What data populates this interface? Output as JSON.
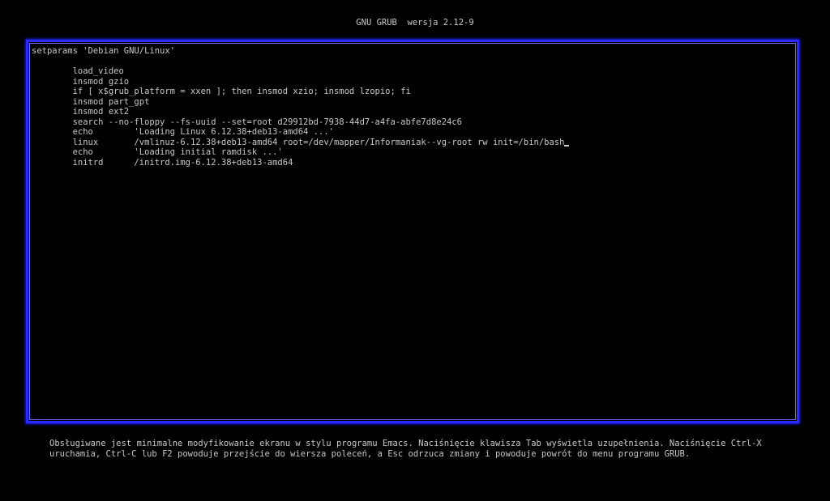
{
  "header": {
    "title": "GNU GRUB  wersja 2.12-9"
  },
  "editor": {
    "lines": [
      "setparams 'Debian GNU/Linux'",
      "",
      "        load_video",
      "        insmod gzio",
      "        if [ x$grub_platform = xxen ]; then insmod xzio; insmod lzopio; fi",
      "        insmod part_gpt",
      "        insmod ext2",
      "        search --no-floppy --fs-uuid --set=root d29912bd-7938-44d7-a4fa-abfe7d8e24c6",
      "        echo        'Loading Linux 6.12.38+deb13-amd64 ...'",
      "        linux       /vmlinuz-6.12.38+deb13-amd64 root=/dev/mapper/Informaniak--vg-root rw init=/bin/bash",
      "        echo        'Loading initial ramdisk ...'",
      "        initrd      /initrd.img-6.12.38+deb13-amd64"
    ],
    "cursor_line": 9
  },
  "help": {
    "line1": "Obsługiwane jest minimalne modyfikowanie ekranu w stylu programu Emacs. Naciśnięcie klawisza Tab wyświetla uzupełnienia. Naciśnięcie Ctrl-X",
    "line2": "uruchamia, Ctrl-C lub F2 powoduje przejście do wiersza poleceń, a Esc odrzuca zmiany i powoduje powrót do menu programu GRUB."
  },
  "colors": {
    "background": "#000000",
    "text": "#c8c8c8",
    "frame": "#2a2aff"
  }
}
